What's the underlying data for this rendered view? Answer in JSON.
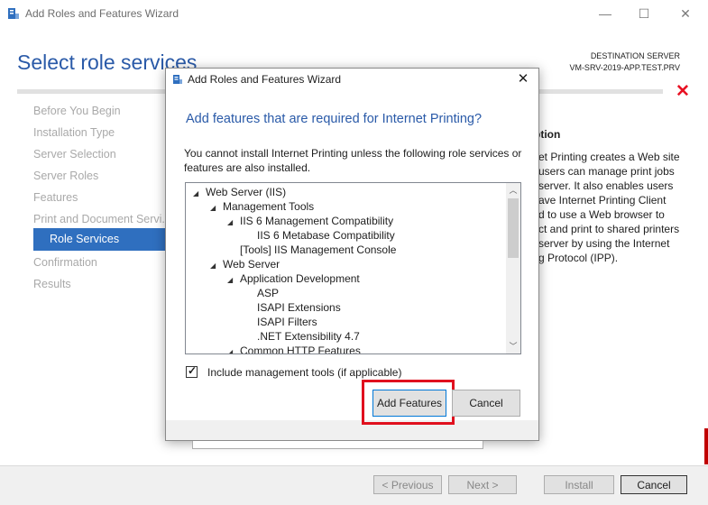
{
  "window": {
    "title": "Add Roles and Features Wizard",
    "controls": {
      "minimize": "—",
      "maximize": "☐",
      "close": "✕"
    }
  },
  "page": {
    "heading": "Select role services",
    "destination_label": "DESTINATION SERVER",
    "destination_server": "VM-SRV-2019-APP.TEST.PRV",
    "error_icon": "✕"
  },
  "nav": {
    "items": [
      {
        "label": "Before You Begin"
      },
      {
        "label": "Installation Type"
      },
      {
        "label": "Server Selection"
      },
      {
        "label": "Server Roles"
      },
      {
        "label": "Features"
      },
      {
        "label": "Print and Document Servi..."
      },
      {
        "label": "Role Services"
      },
      {
        "label": "Confirmation"
      },
      {
        "label": "Results"
      }
    ],
    "active_index": 6
  },
  "description": {
    "heading_fragment": "ption",
    "lines": [
      "et Printing creates a Web site",
      "users can manage print jobs",
      "server. It also enables users",
      "ave Internet Printing Client",
      "d to use a Web browser to",
      "ct and print to shared printers",
      "server by using the Internet",
      "g Protocol (IPP)."
    ]
  },
  "footer": {
    "previous": "< Previous",
    "next": "Next >",
    "install": "Install",
    "cancel": "Cancel"
  },
  "dialog": {
    "title": "Add Roles and Features Wizard",
    "close_glyph": "✕",
    "heading": "Add features that are required for Internet Printing?",
    "message": "You cannot install Internet Printing unless the following role services or features are also installed.",
    "tree": [
      {
        "label": "Web Server (IIS)",
        "level": 0,
        "expanded": true
      },
      {
        "label": "Management Tools",
        "level": 1,
        "expanded": true
      },
      {
        "label": "IIS 6 Management Compatibility",
        "level": 2,
        "expanded": true
      },
      {
        "label": "IIS 6 Metabase Compatibility",
        "level": 3,
        "expanded": false
      },
      {
        "label": "[Tools] IIS Management Console",
        "level": 2,
        "expanded": false
      },
      {
        "label": "Web Server",
        "level": 1,
        "expanded": true
      },
      {
        "label": "Application Development",
        "level": 2,
        "expanded": true
      },
      {
        "label": "ASP",
        "level": 3,
        "expanded": false
      },
      {
        "label": "ISAPI Extensions",
        "level": 3,
        "expanded": false
      },
      {
        "label": "ISAPI Filters",
        "level": 3,
        "expanded": false
      },
      {
        "label": ".NET Extensibility 4.7",
        "level": 3,
        "expanded": false
      },
      {
        "label": "Common HTTP Features",
        "level": 2,
        "expanded": true
      }
    ],
    "checkbox_label": "Include management tools (if applicable)",
    "checkbox_checked": true,
    "add_button": "Add Features",
    "cancel_button": "Cancel"
  },
  "colors": {
    "accent": "#2a5aa8",
    "active_nav": "#2f6fbf",
    "highlight": "#e0101e"
  }
}
